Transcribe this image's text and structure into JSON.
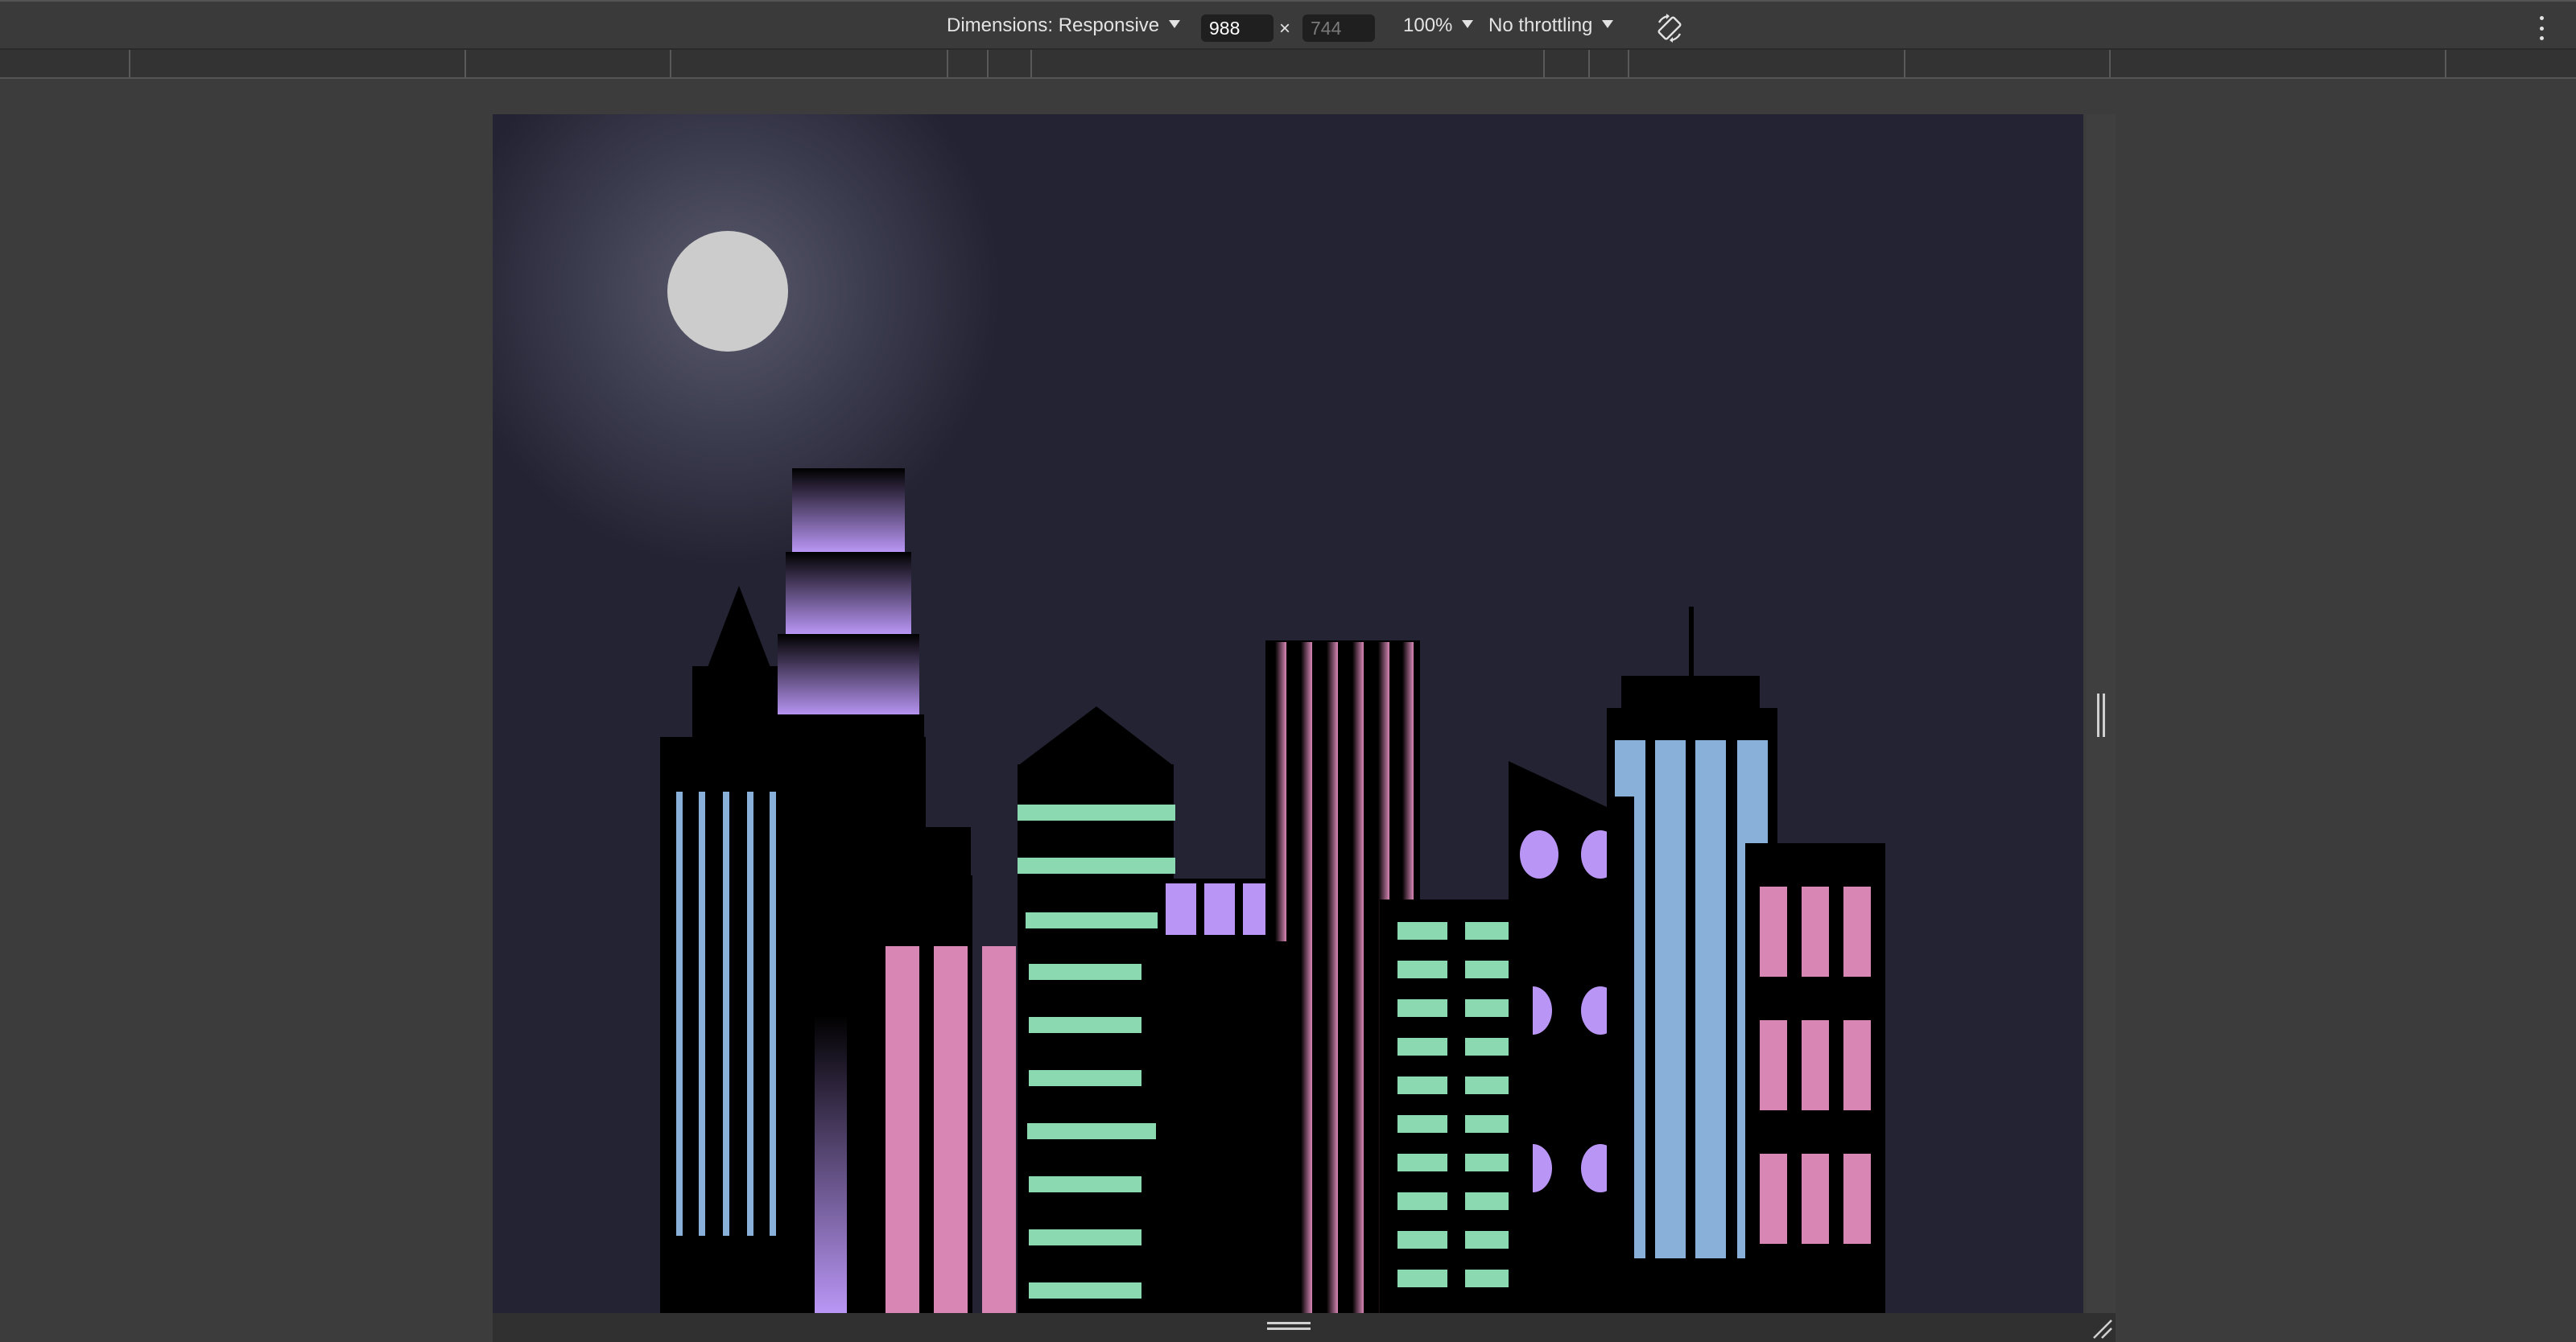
{
  "devtools_toolbar": {
    "dimensions_label": "Dimensions: Responsive",
    "width_value": "988",
    "height_placeholder": "744",
    "times_sign": "×",
    "zoom_label": "100%",
    "throttling_label": "No throttling",
    "icons": [
      "rotate-icon",
      "more-options-icon"
    ]
  },
  "viewport": {
    "scene": "night-city-skyline",
    "colors": {
      "sky": "#232333",
      "moon": "#cccccc",
      "building": "#000000",
      "blue_window": "#89b0d9",
      "pink_window": "#d887b5",
      "green_window": "#8bd9b1",
      "purple_window": "#b996f5"
    }
  }
}
